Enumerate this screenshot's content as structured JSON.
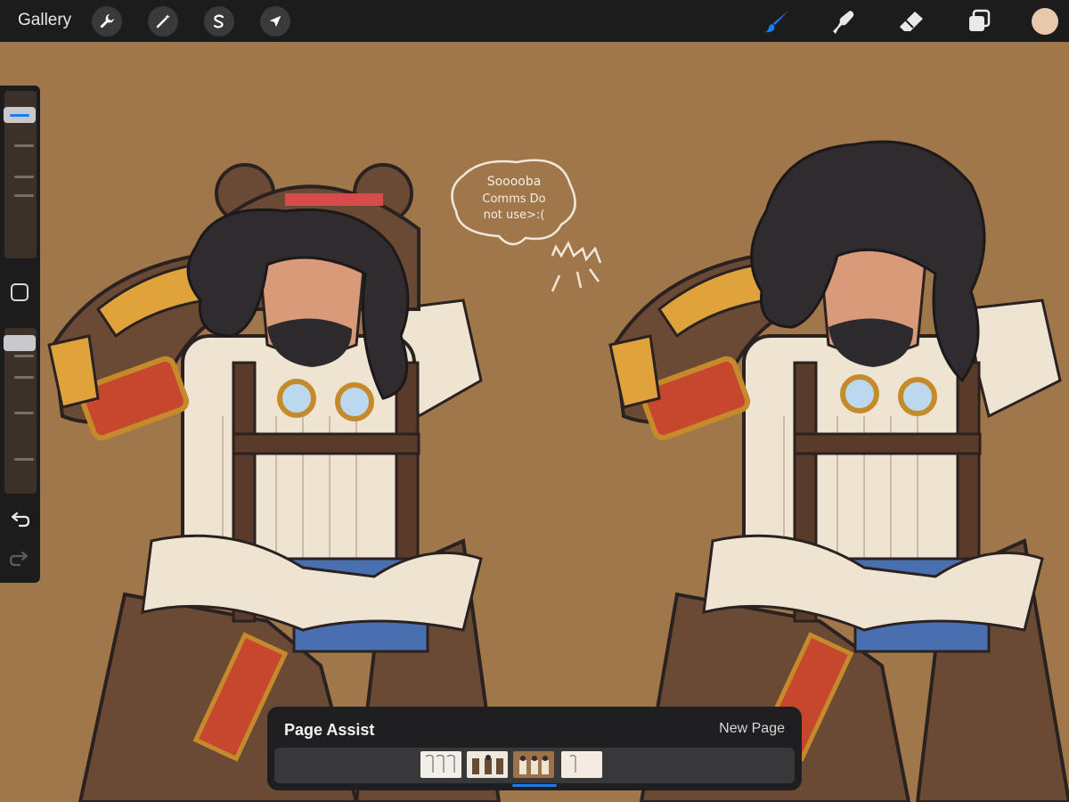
{
  "toolbar": {
    "gallery_label": "Gallery",
    "left_tools": [
      {
        "name": "actions",
        "icon": "wrench-icon"
      },
      {
        "name": "adjustments",
        "icon": "magic-wand-icon"
      },
      {
        "name": "selection",
        "icon": "selection-s-icon"
      },
      {
        "name": "transform",
        "icon": "arrow-cursor-icon"
      }
    ],
    "right_tools": [
      {
        "name": "brush",
        "icon": "brush-icon",
        "active": true
      },
      {
        "name": "smudge",
        "icon": "smudge-finger-icon",
        "active": false
      },
      {
        "name": "eraser",
        "icon": "eraser-icon",
        "active": false
      },
      {
        "name": "layers",
        "icon": "layers-icon",
        "active": false
      }
    ],
    "current_color": "#e8c8aa",
    "accent": "#1a7cf5"
  },
  "sidebar": {
    "brush_size_level": 0.97,
    "opacity_level": 0.82,
    "modifier_icon": "square-modifier-icon",
    "undo_icon": "undo-icon",
    "redo_icon": "redo-icon"
  },
  "canvas": {
    "background_color": "#a0774a",
    "sketch_note_lines": [
      "Sooooba",
      "Comms Do",
      "not use>:("
    ]
  },
  "page_assist": {
    "title": "Page Assist",
    "new_page_label": "New Page",
    "pages": [
      {
        "label": "page-1",
        "tone": "#f2eee8"
      },
      {
        "label": "page-2",
        "tone": "#efe8df"
      },
      {
        "label": "page-3",
        "tone": "#9b7249",
        "active": true
      },
      {
        "label": "page-4",
        "tone": "#f4ebe2"
      }
    ]
  }
}
